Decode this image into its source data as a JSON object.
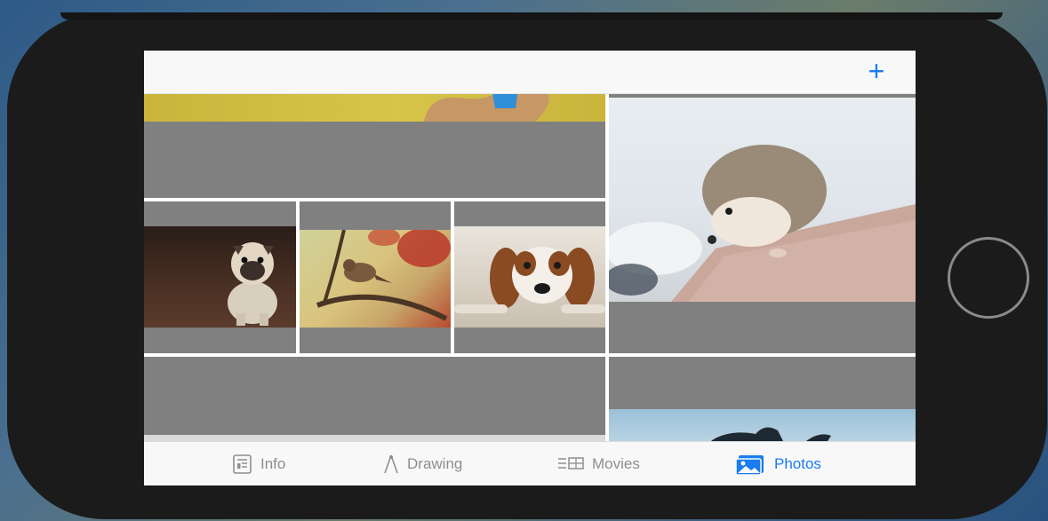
{
  "navbar": {
    "add_label": "+"
  },
  "tabs": [
    {
      "label": "Info",
      "icon": "newspaper-icon",
      "active": false
    },
    {
      "label": "Drawing",
      "icon": "compass-icon",
      "active": false
    },
    {
      "label": "Movies",
      "icon": "film-icon",
      "active": false
    },
    {
      "label": "Photos",
      "icon": "photos-icon",
      "active": true
    }
  ],
  "photos": [
    {
      "subject": "dog-partial",
      "description": "yellow background with dog partially visible"
    },
    {
      "subject": "pug"
    },
    {
      "subject": "sparrow-on-branch"
    },
    {
      "subject": "spaniel"
    },
    {
      "subject": "hedgehog"
    },
    {
      "subject": "animal-partial"
    }
  ],
  "colors": {
    "accent": "#1a7cf0",
    "inactive_tab": "#8e8e93",
    "placeholder": "#808080",
    "phone_body": "#1b1b1b"
  }
}
